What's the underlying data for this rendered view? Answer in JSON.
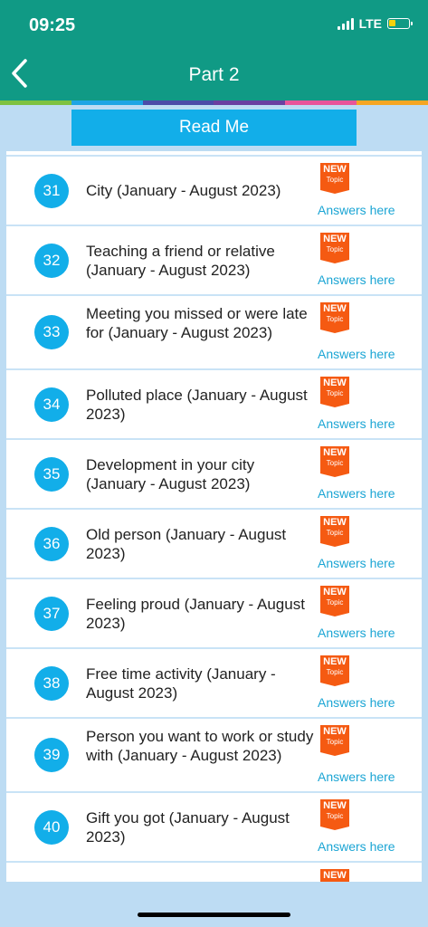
{
  "status": {
    "time": "09:25",
    "network": "LTE"
  },
  "header": {
    "title": "Part 2"
  },
  "colors": {
    "header": "#109a85",
    "accent": "#12aee9",
    "badge": "#f55a12",
    "stripe": [
      "#7ec241",
      "#1da5e4",
      "#4b4ba8",
      "#6a3fa0",
      "#e8559a",
      "#f5a623"
    ]
  },
  "read_me": "Read Me",
  "badge": {
    "line1": "NEW",
    "line2": "Topic"
  },
  "answers_label": "Answers here",
  "items": [
    {
      "number": "31",
      "topic": "City (January - August 2023)"
    },
    {
      "number": "32",
      "topic": "Teaching a friend or relative (January - August 2023)"
    },
    {
      "number": "33",
      "topic": "Meeting you missed or were late for (January - August 2023)"
    },
    {
      "number": "34",
      "topic": "Polluted place (January - August 2023)"
    },
    {
      "number": "35",
      "topic": "Development in your city (January - August 2023)"
    },
    {
      "number": "36",
      "topic": "Old person (January - August 2023)"
    },
    {
      "number": "37",
      "topic": "Feeling proud (January - August 2023)"
    },
    {
      "number": "38",
      "topic": "Free time activity (January - August 2023)"
    },
    {
      "number": "39",
      "topic": "Person you want to work or study with (January - August 2023)"
    },
    {
      "number": "40",
      "topic": "Gift you got (January - August 2023)"
    },
    {
      "number": "",
      "topic": ""
    }
  ]
}
